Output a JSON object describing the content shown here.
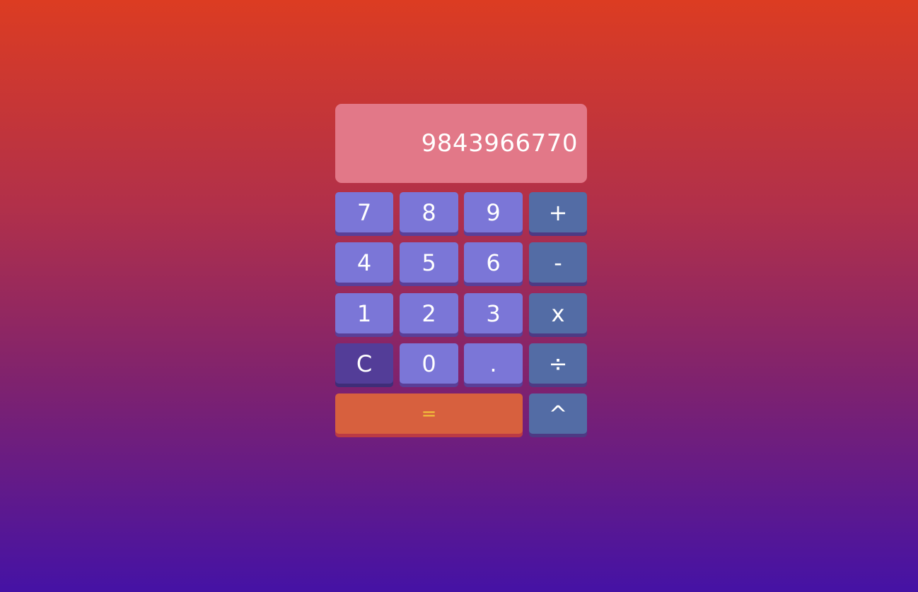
{
  "display": {
    "value": "9843966770"
  },
  "keys": {
    "k7": "7",
    "k8": "8",
    "k9": "9",
    "plus": "+",
    "k4": "4",
    "k5": "5",
    "k6": "6",
    "minus": "-",
    "k1": "1",
    "k2": "2",
    "k3": "3",
    "multiply": "x",
    "clear": "C",
    "k0": "0",
    "dot": ".",
    "divide": "÷",
    "equals": "=",
    "power": "^"
  },
  "colors": {
    "background_top": "#dc3c22",
    "background_bottom": "#4512a5",
    "display_bg": "#e27888",
    "number_key": "#7b76d7",
    "operator_key": "#536ca5",
    "clear_key": "#533d98",
    "equals_key": "#d7603e",
    "equals_text": "#f3c23b"
  }
}
